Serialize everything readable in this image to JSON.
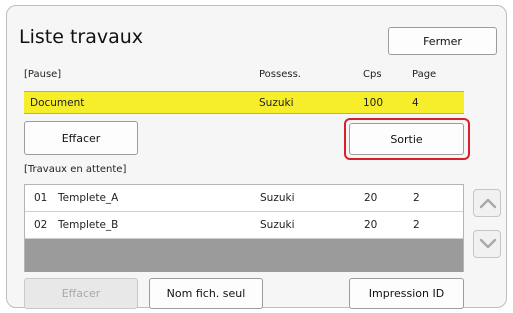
{
  "window": {
    "title": "Liste travaux",
    "close_label": "Fermer"
  },
  "paused": {
    "section_label": "[Pause]",
    "columns": {
      "owner": "Possess.",
      "copies": "Cps",
      "page": "Page"
    },
    "job": {
      "name": "Document",
      "owner": "Suzuki",
      "copies": "100",
      "page": "4"
    },
    "delete_label": "Effacer",
    "output_label": "Sortie"
  },
  "waiting": {
    "section_label": "[Travaux en attente]",
    "rows": [
      {
        "num": "01",
        "name": "Templete_A",
        "owner": "Suzuki",
        "copies": "20",
        "page": "2"
      },
      {
        "num": "02",
        "name": "Templete_B",
        "owner": "Suzuki",
        "copies": "20",
        "page": "2"
      }
    ],
    "scroll_up_icon": "chevron-up-icon",
    "scroll_down_icon": "chevron-down-icon"
  },
  "footer": {
    "delete_label": "Effacer",
    "filename_only_label": "Nom fich. seul",
    "print_id_label": "Impression ID"
  },
  "colors": {
    "selected_row": "#f7ee2b",
    "highlight": "#d8202a",
    "empty_row": "#9b9b9b"
  }
}
